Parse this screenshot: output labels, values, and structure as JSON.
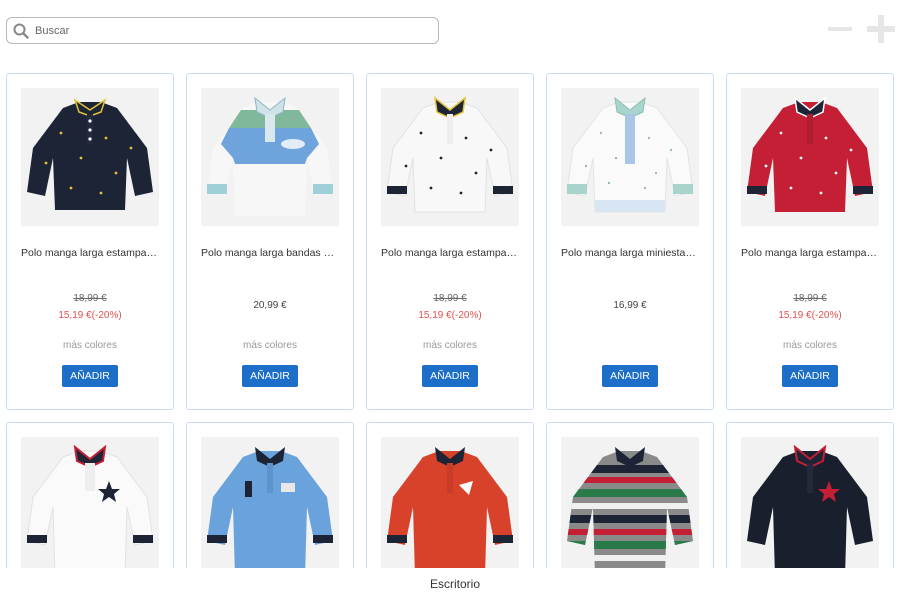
{
  "search": {
    "placeholder": "Buscar"
  },
  "add_label": "AÑADIR",
  "more_colors_label": "más colores",
  "products_row1": [
    {
      "name": "Polo manga larga estampa…",
      "old_price": "18,99 €",
      "sale_price": "15,19 €(-20%)",
      "more_colors": true
    },
    {
      "name": "Polo manga larga bandas …",
      "price": "20,99 €",
      "more_colors": true
    },
    {
      "name": "Polo manga larga estampa…",
      "old_price": "18,99 €",
      "sale_price": "15,19 €(-20%)",
      "more_colors": true
    },
    {
      "name": "Polo manga larga miniesta…",
      "price": "16,99 €",
      "more_colors": false
    },
    {
      "name": "Polo manga larga estampa…",
      "old_price": "18,99 €",
      "sale_price": "15,19 €(-20%)",
      "more_colors": true
    }
  ],
  "footer": {
    "label": "Escritorio"
  },
  "colors": {
    "accent": "#1d6ec8",
    "sale": "#e05050",
    "card_border": "#c9dcf6"
  }
}
